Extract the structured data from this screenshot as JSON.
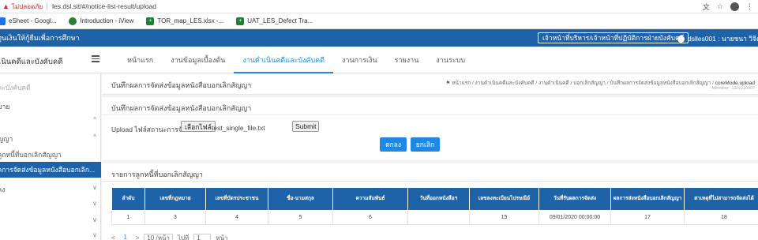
{
  "browser": {
    "insecure_label": "ไม่ปลอดภัย",
    "url": "les.dsl.sit/#/notice-list-result/upload",
    "bookmarks": [
      {
        "label": "eSheet - Googl..."
      },
      {
        "label": "Introduction - iView"
      },
      {
        "label": "TOR_map_LES.xlsx -..."
      },
      {
        "label": "UAT_LES_Defect Tra..."
      }
    ]
  },
  "topbar": {
    "left_text": "ทุนเงินให้กู้ยืมเพื่อการศึกษา",
    "role_text": "เจ้าหน้าที่บริหาร/เจ้าหน้าที่ปฏิบัติการฝ่ายบังคับคดี",
    "user_text": "dslles001 : นายชนา วิจิต"
  },
  "nav": {
    "brand": "เนินคดีและบังคับคดี",
    "tabs": [
      {
        "label": "หน้าแรก",
        "active": false
      },
      {
        "label": "งานข้อมูลเบื้องต้น",
        "active": false
      },
      {
        "label": "งานดำเนินคดีและบังคับคดี",
        "active": true
      },
      {
        "label": "งานการเงิน",
        "active": false
      },
      {
        "label": "รายงาน",
        "active": false
      },
      {
        "label": "งานระบบ",
        "active": false
      }
    ]
  },
  "sidebar": {
    "items": [
      {
        "label": "ละบังคับคดี",
        "muted": true,
        "chevron": ""
      },
      {
        "label": "มาย",
        "muted": false,
        "chevron": ""
      },
      {
        "label": "",
        "muted": false,
        "chevron": "^"
      },
      {
        "label": "ัญญา",
        "muted": false,
        "chevron": "^"
      },
      {
        "label": "ลูกหนี้ที่บอกเลิกสัญญา",
        "muted": false,
        "chevron": ""
      },
      {
        "label": "ลการจัดส่งข้อมูลหนังสือบอกเลิก...",
        "active": true,
        "chevron": ""
      },
      {
        "label": "ลง",
        "muted": false,
        "chevron": "v"
      },
      {
        "label": "",
        "muted": false,
        "chevron": "v"
      },
      {
        "label": "",
        "muted": false,
        "chevron": "v"
      },
      {
        "label": "",
        "muted": false,
        "chevron": "v"
      }
    ]
  },
  "page": {
    "title": "บันทึกผลการจัดส่งข้อมูลหนังสือบอกเลิกสัญญา",
    "breadcrumb": "หน้าแรก / งานดำเนินคดีและบังคับคดี / งานดำเนินคดี / บอกเลิกสัญญา / บันทึกผลการจัดส่งข้อมูลหนังสือบอกเลิกสัญญา /",
    "breadcrumb_current": "coreMode.upload",
    "screen_code": "Identifier : LES010007"
  },
  "upload_card": {
    "title": "บันทึกผลการจัดส่งข้อมูลหนังสือบอกเลิกสัญญา",
    "upload_label": "Upload ไฟล์สถานะการจัดส่ง",
    "choose_file_label": "เลือกไฟล์",
    "file_name": "test_single_file.txt",
    "submit_label": "Submit",
    "ok_label": "ตกลง",
    "cancel_label": "ยกเลิก"
  },
  "list_card": {
    "title": "รายการลูกหนี้ที่บอกเลิกสัญญา",
    "columns": [
      "ลำดับ",
      "เลขที่กฎหมาย",
      "เลขที่บัตรประชาชน",
      "ชื่อ-นามสกุล",
      "ความสัมพันธ์",
      "วันที่ออกหนังสือฯ",
      "เลขลงทะเบียนไปรษณีย์",
      "วันที่รับผลการจัดส่ง",
      "ผลการส่งหนังสือบอกเลิกสัญญา",
      "สาเหตุที่ไม่สามารถจัดส่งได้"
    ],
    "rows": [
      [
        "1",
        "3",
        "4",
        "5",
        "6",
        "",
        "15",
        "09/01/2020 00:00:00",
        "17",
        "18"
      ]
    ]
  },
  "pager": {
    "prev": "<",
    "page": "1",
    "next": ">",
    "page_size": "10 /หน้า",
    "goto_label": "ไปที่",
    "goto_value": "1",
    "page_suffix": "หน้า"
  },
  "colors": {
    "primary": "#1e62a8",
    "accent": "#1e88e5"
  }
}
